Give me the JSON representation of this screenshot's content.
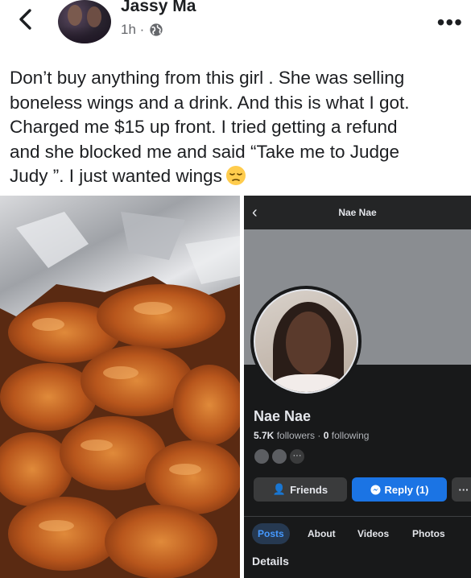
{
  "post": {
    "author": "Jassy Ma",
    "time": "1h ·",
    "privacy_icon": "globe-icon",
    "more_icon": "more-dots-icon",
    "back_icon": "chevron-left-icon",
    "text_lines": [
      "Don’t buy anything from this girl . She was selling",
      "boneless wings and a drink. And this is what I got.",
      "Charged me $15 up front. I tried getting a refund",
      "and she blocked me and said “Take me to Judge",
      "Judy ”. I just wanted wings"
    ],
    "emoji": "pensive-face-emoji"
  },
  "photos": {
    "left": {
      "subject": "boneless-wings-in-foil"
    },
    "right": {
      "topbar_title": "Nae Nae",
      "profile_name": "Nae Nae",
      "followers_count": "5.7K",
      "followers_label": "followers",
      "separator": "·",
      "following_count": "0",
      "following_label": "following",
      "mutuals_more": "···",
      "buttons": {
        "friends": "Friends",
        "reply": "Reply (1)",
        "more": "···"
      },
      "tabs": [
        "Posts",
        "About",
        "Videos",
        "Photos"
      ],
      "active_tab": "Posts",
      "details_heading": "Details",
      "colors": {
        "background": "#18191a",
        "accent_blue": "#1b74e4",
        "tab_active_text": "#4599ff"
      }
    }
  }
}
